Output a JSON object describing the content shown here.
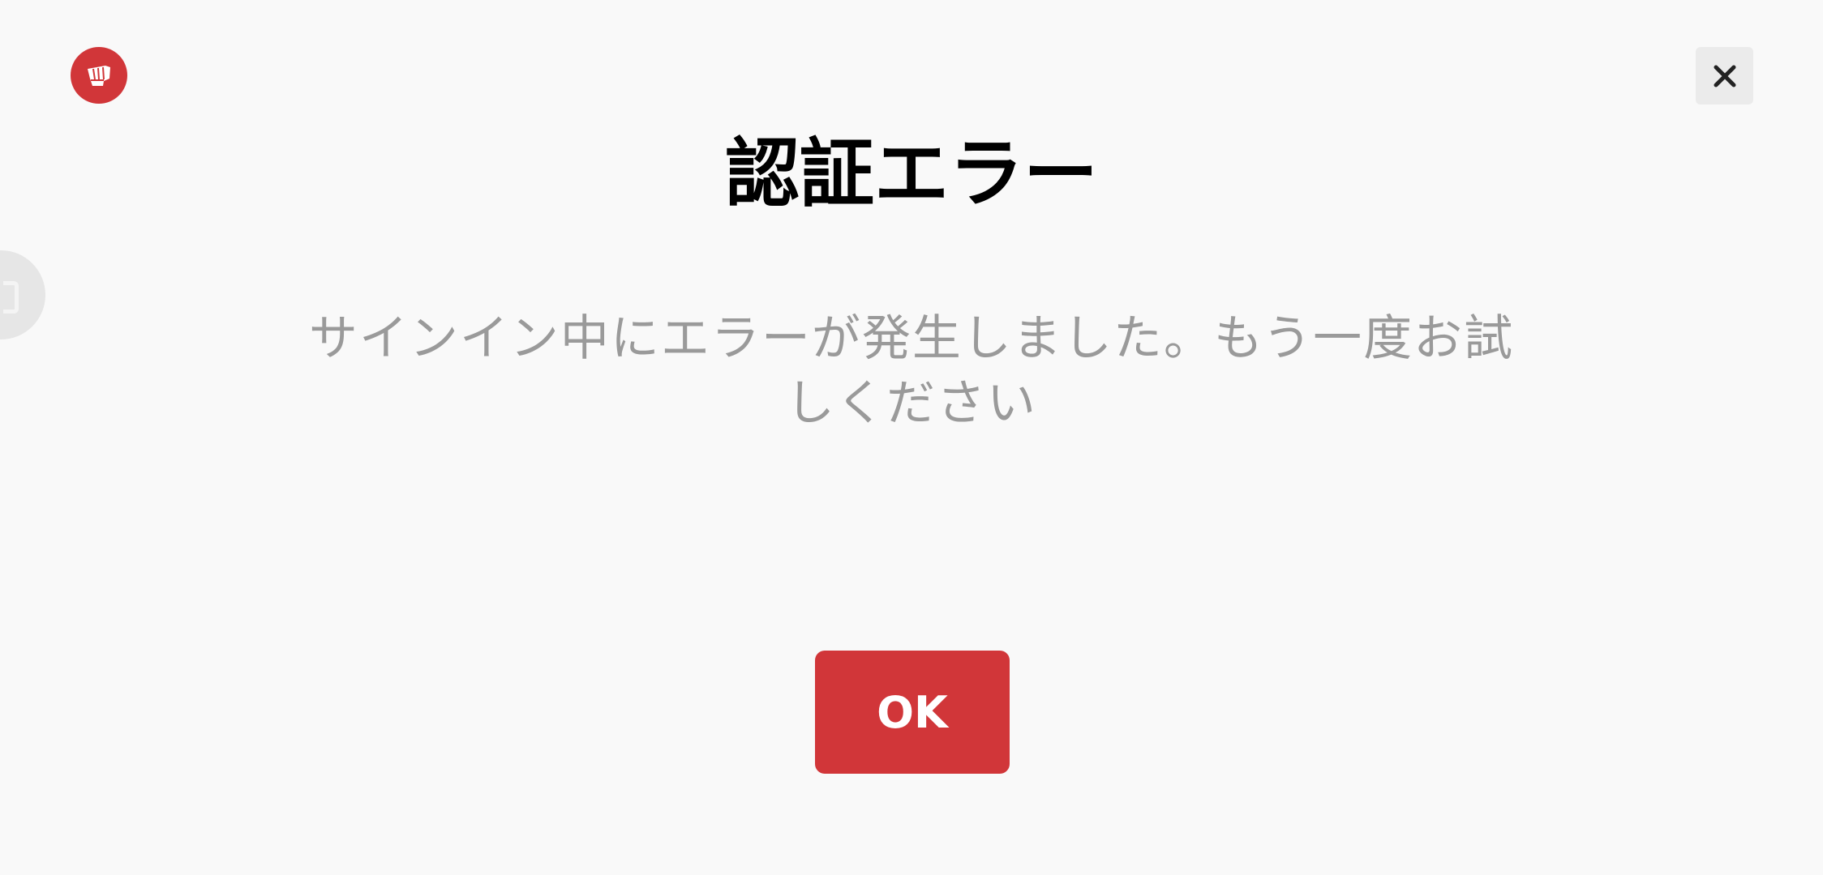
{
  "dialog": {
    "title": "認証エラー",
    "message": "サインイン中にエラーが発生しました。もう一度お試しください",
    "ok_label": "OK"
  },
  "icons": {
    "logo": "riot-fist-logo-icon",
    "close": "close-icon",
    "side_tab": "side-panel-tab-icon"
  },
  "colors": {
    "accent": "#d13639",
    "background": "#f9f9f9",
    "title_text": "#000000",
    "message_text": "#9a9a9a",
    "close_button_bg": "#ebebeb",
    "close_icon": "#222222"
  }
}
